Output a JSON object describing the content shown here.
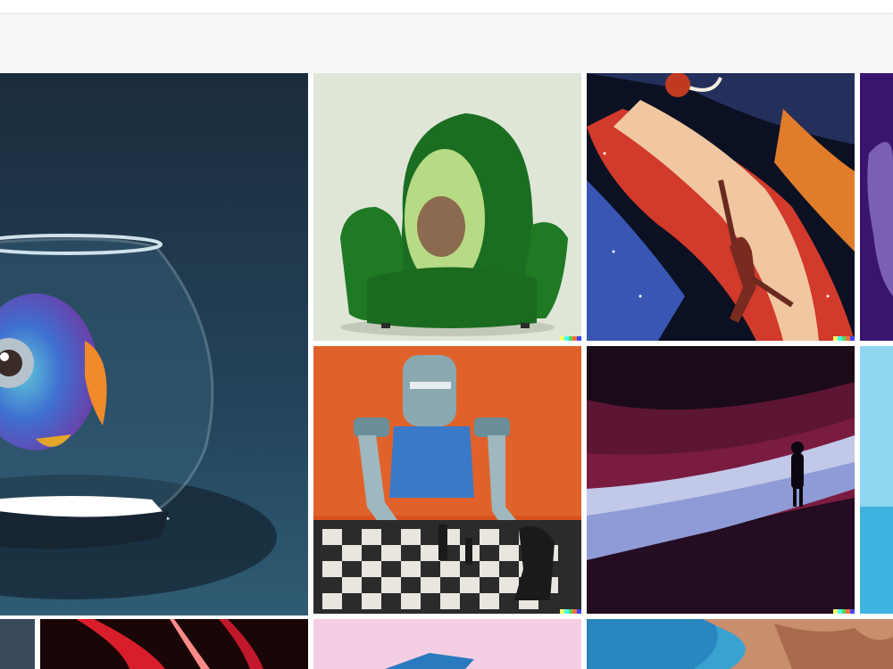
{
  "page": {
    "description_hidden": ""
  },
  "gallery": {
    "tiles": [
      {
        "id": "fishbowl",
        "name": "fishbowl-fish-image"
      },
      {
        "id": "avocado",
        "name": "avocado-armchair-image"
      },
      {
        "id": "space-dunk",
        "name": "space-basketball-image"
      },
      {
        "id": "purple-partial",
        "name": "purple-partial-image"
      },
      {
        "id": "robot-chess",
        "name": "robot-chess-image"
      },
      {
        "id": "desert-figure",
        "name": "desert-figure-image"
      },
      {
        "id": "sky-partial",
        "name": "sky-partial-image"
      },
      {
        "id": "bottom-dark",
        "name": "bottom-dark-image"
      },
      {
        "id": "bottom-neon",
        "name": "bottom-neon-image"
      },
      {
        "id": "bottom-pink",
        "name": "bottom-pink-image"
      },
      {
        "id": "bottom-ocean",
        "name": "bottom-ocean-image"
      }
    ],
    "watermark_colors": [
      "#ffff66",
      "#42ffff",
      "#51da4c",
      "#ff6e3c",
      "#3c46ff"
    ]
  }
}
